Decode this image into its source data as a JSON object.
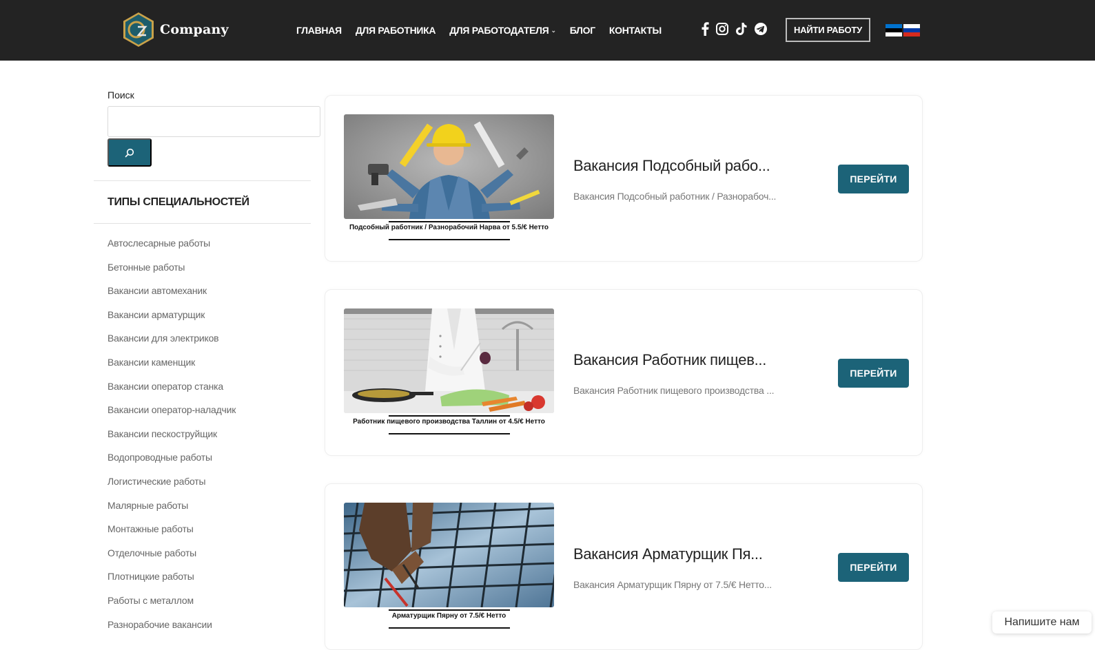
{
  "header": {
    "logo_text": "Company",
    "nav": [
      {
        "label": "ГЛАВНАЯ",
        "has_dropdown": false
      },
      {
        "label": "ДЛЯ РАБОТНИКА",
        "has_dropdown": false
      },
      {
        "label": "ДЛЯ РАБОТОДАТЕЛЯ",
        "has_dropdown": true
      },
      {
        "label": "БЛОГ",
        "has_dropdown": false
      },
      {
        "label": "КОНТАКТЫ",
        "has_dropdown": false
      }
    ],
    "social_icons": [
      "facebook-icon",
      "instagram-icon",
      "tiktok-icon",
      "telegram-icon"
    ],
    "cta_label": "НАЙТИ РАБОТУ",
    "languages": [
      {
        "code": "et",
        "colors": [
          "#0072ce",
          "#000000",
          "#ffffff"
        ]
      },
      {
        "code": "ru",
        "colors": [
          "#ffffff",
          "#0039a6",
          "#d52b1e"
        ]
      }
    ]
  },
  "sidebar": {
    "search_label": "Поиск",
    "search_value": "",
    "categories_title": "ТИПЫ СПЕЦИАЛЬНОСТЕЙ",
    "categories": [
      "Автослесарные работы",
      "Бетонные работы",
      "Вакансии автомеханик",
      "Вакансии арматурщик",
      "Вакансии для электриков",
      "Вакансии каменщик",
      "Вакансии оператор станка",
      "Вакансии оператор-наладчик",
      "Вакансии пескоструйщик",
      "Водопроводные работы",
      "Логистические работы",
      "Малярные работы",
      "Монтажные работы",
      "Отделочные работы",
      "Плотницкие работы",
      "Работы с металлом",
      "Разнорабочие вакансии"
    ]
  },
  "vacancies": [
    {
      "image_caption": "Подсобный работник / Разнорабочий Нарва от 5.5/€ Нетто",
      "title": "Вакансия Подсобный рабо...",
      "excerpt": "Вакансия Подсобный работник / Разнорабоч...",
      "button_label": "ПЕРЕЙТИ"
    },
    {
      "image_caption": "Работник пищевого производства Таллин от 4.5/€ Нетто",
      "title": "Вакансия Работник пищев...",
      "excerpt": "Вакансия Работник пищевого производства ...",
      "button_label": "ПЕРЕЙТИ"
    },
    {
      "image_caption": "Арматурщик Пярну от 7.5/€ Нетто",
      "title": "Вакансия Арматурщик Пя...",
      "excerpt": "Вакансия Арматурщик Пярну от 7.5/€ Нетто...",
      "button_label": "ПЕРЕЙТИ"
    }
  ],
  "chat": {
    "label": "Напишите нам"
  },
  "colors": {
    "header_bg": "#232323",
    "accent": "#1c6378",
    "logo_hex": "#1d5d6b",
    "logo_gold": "#c9a24a"
  }
}
